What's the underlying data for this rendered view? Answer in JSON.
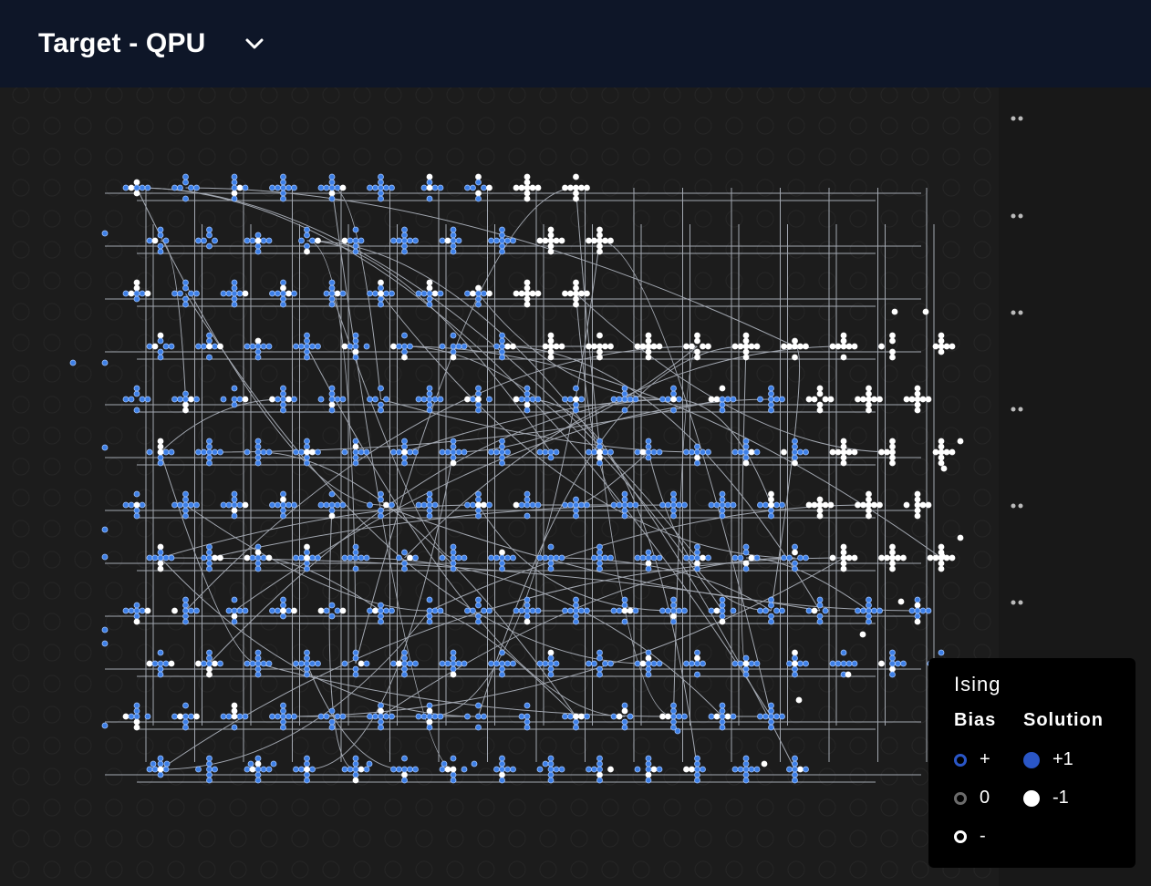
{
  "header": {
    "title": "Target - QPU"
  },
  "icons": {
    "dropdown": "chevron-down-icon"
  },
  "colors": {
    "header_bg": "#0e1628",
    "canvas_bg": "#1c1c1c",
    "node_blue": "#3d7fe6",
    "node_white": "#ffffff",
    "edge": "#cfd6e2",
    "legend_bg": "#000000",
    "bias_plus": "#2a56c6",
    "bias_zero": "#6b6b6b",
    "bias_minus": "#ffffff",
    "solution_plus": "#2a56c6",
    "solution_minus": "#ffffff"
  },
  "legend": {
    "title": "Ising",
    "bias_header": "Bias",
    "solution_header": "Solution",
    "bias_items": [
      {
        "label": "+",
        "color": "#2a56c6"
      },
      {
        "label": "0",
        "color": "#6b6b6b"
      },
      {
        "label": "-",
        "color": "#ffffff"
      }
    ],
    "solution_items": [
      {
        "label": "+1",
        "color": "#2a56c6"
      },
      {
        "label": "-1",
        "color": "#ffffff"
      }
    ]
  }
}
